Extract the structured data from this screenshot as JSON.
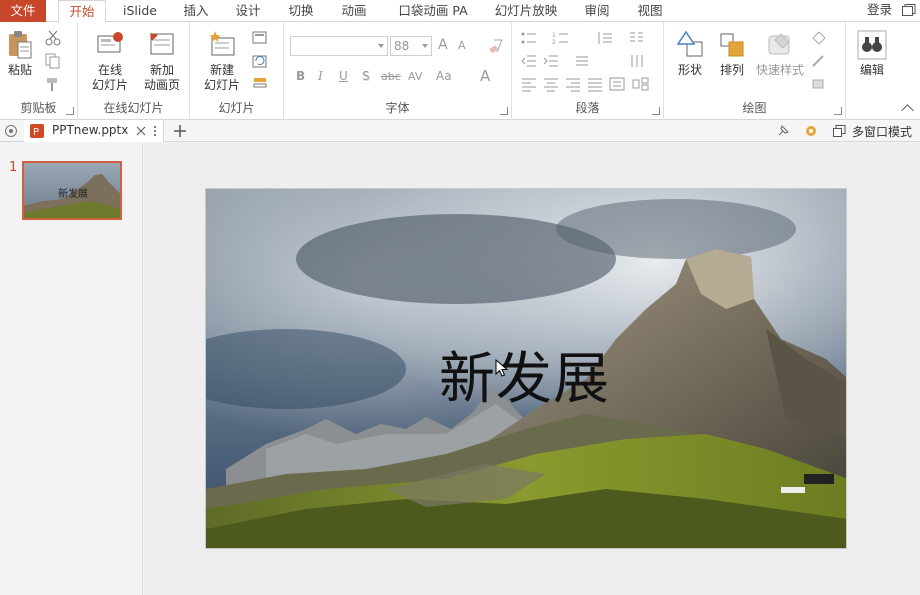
{
  "menu": {
    "tabs": [
      "文件",
      "开始",
      "iSlide",
      "插入",
      "设计",
      "切换",
      "动画",
      "口袋动画 PA",
      "幻灯片放映",
      "审阅",
      "视图"
    ],
    "active_tab": "开始",
    "login": "登录"
  },
  "ribbon": {
    "clipboard": {
      "paste": "粘贴",
      "label": "剪贴板"
    },
    "online": {
      "online_slide": "在线\n幻灯片",
      "online_slide_line1": "在线",
      "online_slide_line2": "幻灯片",
      "new_anim_line1": "新加",
      "new_anim_line2": "动画页",
      "label": "在线幻灯片"
    },
    "slides": {
      "new_slide_line1": "新建",
      "new_slide_line2": "幻灯片",
      "label": "幻灯片"
    },
    "font": {
      "font_name": "",
      "font_size": "88",
      "label": "字体",
      "bold": "B",
      "italic": "I",
      "underline": "U",
      "shadow": "S",
      "strike": "abc",
      "spacing": "AV",
      "aa": "Aa",
      "grow": "A",
      "shrink": "A"
    },
    "paragraph": {
      "label": "段落"
    },
    "drawing": {
      "shapes": "形状",
      "arrange": "排列",
      "quick_styles": "快速样式",
      "label": "绘图"
    },
    "editing": {
      "edit": "编辑"
    }
  },
  "docbar": {
    "filename": "PPTnew.pptx",
    "multi_window": "多窗口模式"
  },
  "thumbnails": [
    {
      "number": "1",
      "title": "新发展"
    }
  ],
  "slide": {
    "title": "新发展"
  },
  "colors": {
    "accent": "#c8472b",
    "file_tab": "#c8472b",
    "thumb_border": "#d0623f"
  }
}
